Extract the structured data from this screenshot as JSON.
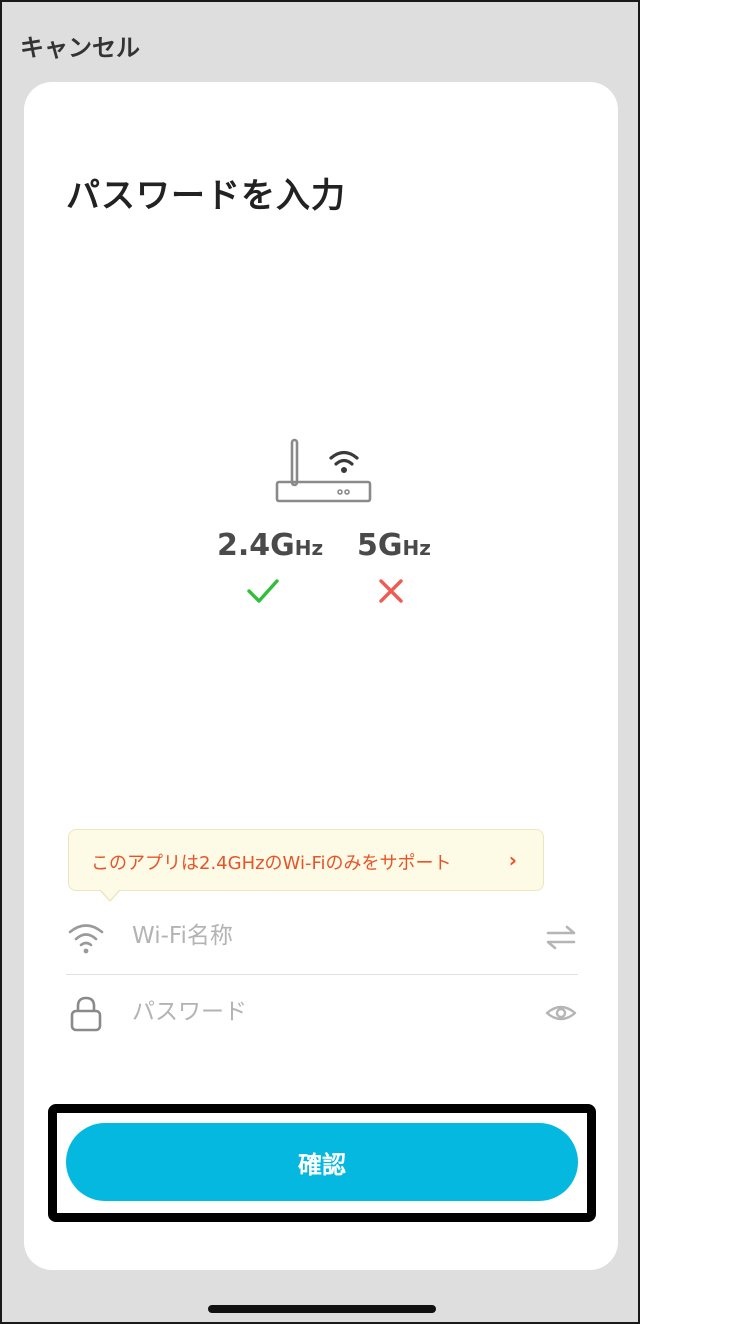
{
  "nav": {
    "cancel_label": "キャンセル"
  },
  "page": {
    "title": "パスワードを入力"
  },
  "router_illustration": {
    "icon": "router-wifi-icon",
    "bands": [
      {
        "value": "2.4",
        "unit": "GHz",
        "supported": true,
        "status_icon": "check-icon",
        "status_color": "#2fbf3a"
      },
      {
        "value": "5",
        "unit": "GHz",
        "supported": false,
        "status_icon": "close-icon",
        "status_color": "#ef5a52"
      }
    ]
  },
  "support_tip": {
    "text": "このアプリは2.4GHzのWi-Fiのみをサポート",
    "chevron": "›"
  },
  "wifi_field": {
    "placeholder": "Wi-Fi名称",
    "value": "",
    "left_icon": "wifi-icon",
    "right_icon": "swap-arrows-icon"
  },
  "password_field": {
    "placeholder": "パスワード",
    "value": "",
    "left_icon": "lock-icon",
    "right_icon": "eye-icon"
  },
  "confirm": {
    "label": "確認"
  },
  "colors": {
    "accent": "#04b8e0",
    "warning_text": "#e8542a",
    "tip_background": "#fdfbe6"
  }
}
